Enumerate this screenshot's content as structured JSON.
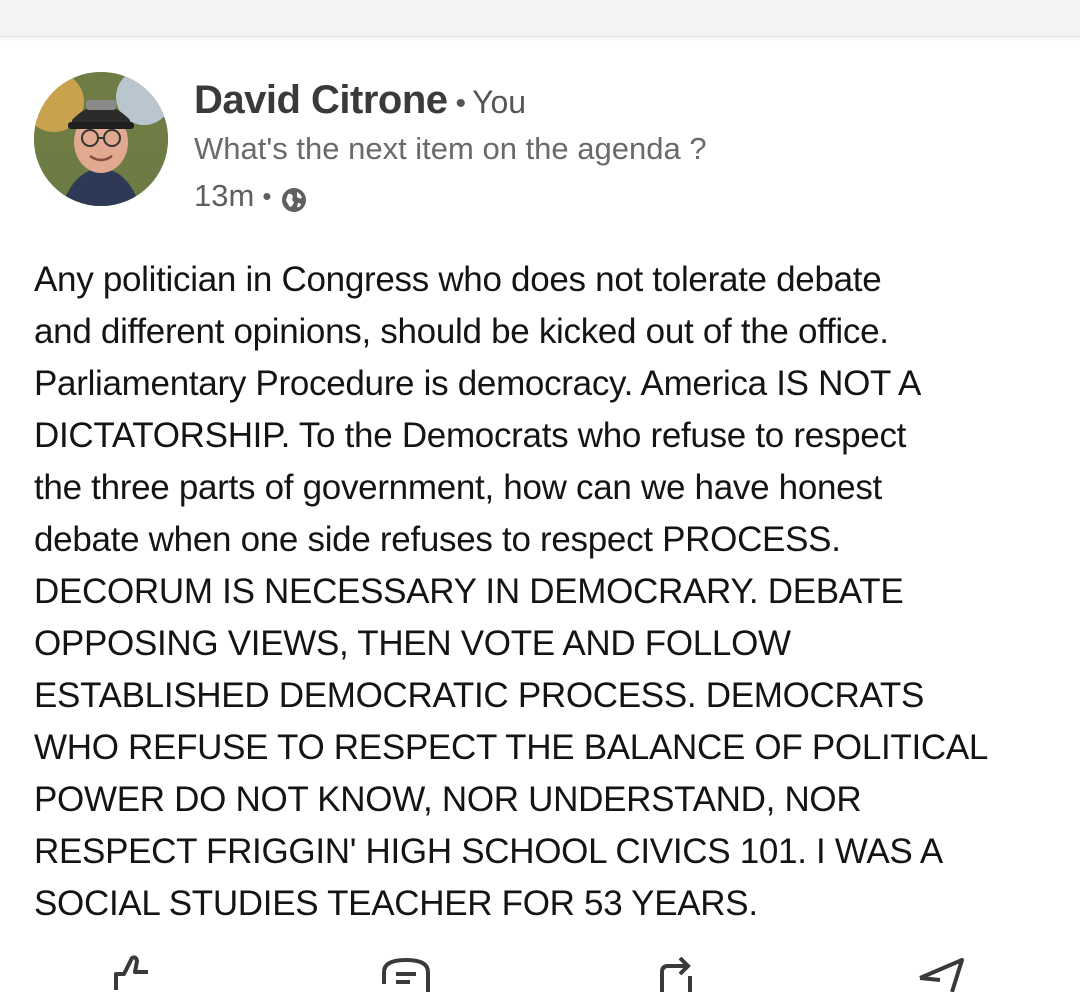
{
  "post": {
    "author": "David Citrone",
    "separator": "•",
    "relation": "You",
    "headline": "What's the next item on the agenda ?",
    "time": "13m",
    "visibility_icon": "globe-icon",
    "body_lines": [
      "Any politician in Congress who does not tolerate debate",
      "and different opinions,  should be kicked out of the office.",
      "Parliamentary Procedure is democracy. America IS NOT A",
      "DICTATORSHIP. To the Democrats who refuse to respect",
      "the three  parts of government,  how can we have honest",
      "debate when one side refuses to respect PROCESS.",
      "DECORUM IS NECESSARY IN DEMOCRARY. DEBATE",
      "OPPOSING VIEWS, THEN VOTE AND FOLLOW",
      "ESTABLISHED DEMOCRATIC PROCESS. DEMOCRATS",
      "WHO REFUSE TO RESPECT THE BALANCE OF POLITICAL",
      "POWER DO NOT KNOW, NOR UNDERSTAND,  NOR",
      "RESPECT FRIGGIN' HIGH SCHOOL CIVICS 101. I WAS A",
      "SOCIAL STUDIES TEACHER FOR 53 YEARS."
    ]
  },
  "actions": {
    "like_icon": "thumbs-up-icon",
    "comment_icon": "comment-icon",
    "repost_icon": "repost-icon",
    "send_icon": "send-icon"
  }
}
